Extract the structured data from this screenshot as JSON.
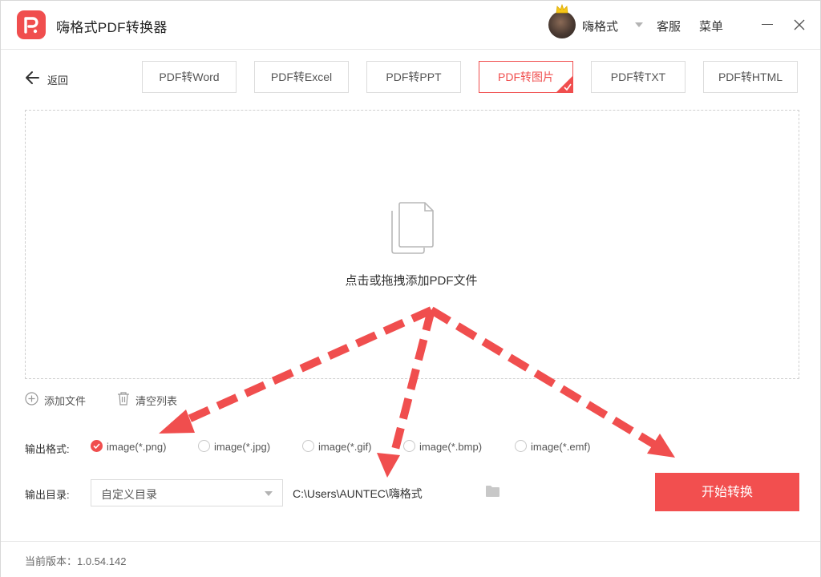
{
  "app": {
    "title": "嗨格式PDF转换器"
  },
  "header": {
    "user_name": "嗨格式",
    "service_label": "客服",
    "menu_label": "菜单"
  },
  "nav": {
    "back_label": "返回"
  },
  "tabs": [
    {
      "label": "PDF转Word",
      "active": false
    },
    {
      "label": "PDF转Excel",
      "active": false
    },
    {
      "label": "PDF转PPT",
      "active": false
    },
    {
      "label": "PDF转图片",
      "active": true
    },
    {
      "label": "PDF转TXT",
      "active": false
    },
    {
      "label": "PDF转HTML",
      "active": false
    }
  ],
  "dropzone": {
    "prompt": "点击或拖拽添加PDF文件"
  },
  "file_actions": {
    "add_label": "添加文件",
    "clear_label": "清空列表"
  },
  "output_format": {
    "label": "输出格式:",
    "options": [
      {
        "label": "image(*.png)",
        "selected": true
      },
      {
        "label": "image(*.jpg)",
        "selected": false
      },
      {
        "label": "image(*.gif)",
        "selected": false
      },
      {
        "label": "image(*.bmp)",
        "selected": false
      },
      {
        "label": "image(*.emf)",
        "selected": false
      }
    ]
  },
  "output_dir": {
    "label": "输出目录:",
    "select_value": "自定义目录",
    "path": "C:\\Users\\AUNTEC\\嗨格式"
  },
  "start_button": {
    "label": "开始转换"
  },
  "footer": {
    "version_label": "当前版本：1.0.54.142"
  },
  "colors": {
    "accent": "#f04e4e",
    "annotation_arrow": "#f04e4e"
  },
  "icons": [
    "app-logo-icon",
    "crown-icon",
    "chevron-down-icon",
    "minimize-icon",
    "close-icon",
    "back-arrow-icon",
    "check-corner-icon",
    "document-icon",
    "plus-circle-icon",
    "trash-icon",
    "radio-check-icon",
    "folder-icon"
  ]
}
